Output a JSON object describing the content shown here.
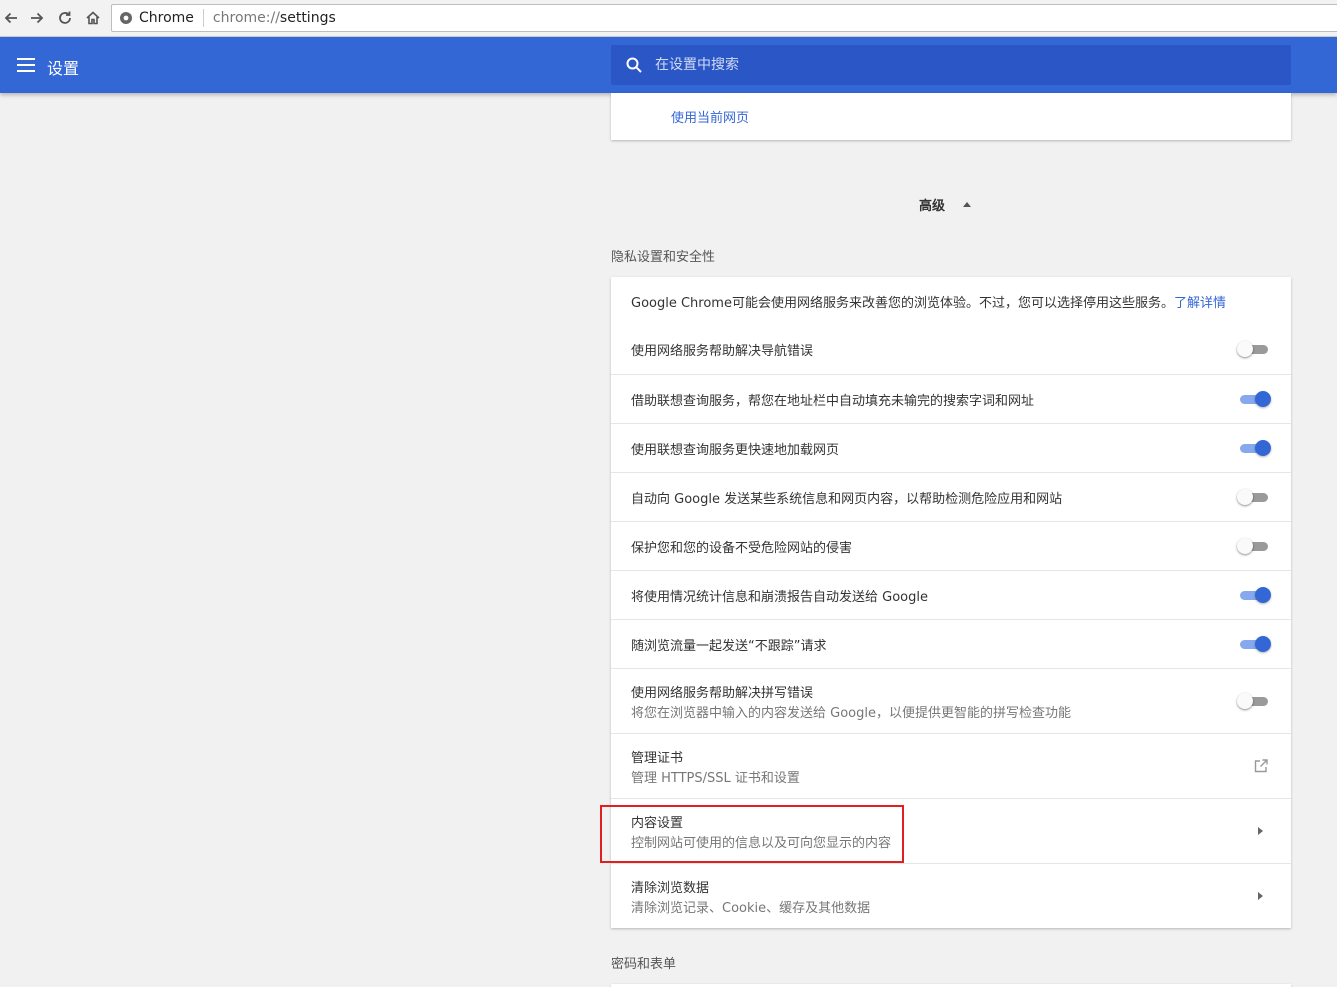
{
  "browser": {
    "site_name": "Chrome",
    "url_scheme": "chrome://",
    "url_path": "settings"
  },
  "header": {
    "title": "设置",
    "search_placeholder": "在设置中搜索"
  },
  "startup": {
    "use_current_pages": "使用当前网页"
  },
  "advanced": {
    "label": "高级"
  },
  "privacy": {
    "section_title": "隐私设置和安全性",
    "intro_text": "Google Chrome可能会使用网络服务来改善您的浏览体验。不过，您可以选择停用这些服务。",
    "learn_more": "了解详情",
    "toggles": [
      {
        "label": "使用网络服务帮助解决导航错误",
        "enabled": false
      },
      {
        "label": "借助联想查询服务，帮您在地址栏中自动填充未输完的搜索字词和网址",
        "enabled": true
      },
      {
        "label": "使用联想查询服务更快速地加载网页",
        "enabled": true
      },
      {
        "label": "自动向 Google 发送某些系统信息和网页内容，以帮助检测危险应用和网站",
        "enabled": false
      },
      {
        "label": "保护您和您的设备不受危险网站的侵害",
        "enabled": false
      },
      {
        "label": "将使用情况统计信息和崩溃报告自动发送给 Google",
        "enabled": true
      },
      {
        "label": "随浏览流量一起发送“不跟踪”请求",
        "enabled": true
      }
    ],
    "spelling": {
      "label": "使用网络服务帮助解决拼写错误",
      "sub": "将您在浏览器中输入的内容发送给 Google，以便提供更智能的拼写检查功能",
      "enabled": false
    },
    "certificates": {
      "label": "管理证书",
      "sub": "管理 HTTPS/SSL 证书和设置"
    },
    "content_settings": {
      "label": "内容设置",
      "sub": "控制网站可使用的信息以及可向您显示的内容"
    },
    "clear_data": {
      "label": "清除浏览数据",
      "sub": "清除浏览记录、Cookie、缓存及其他数据"
    }
  },
  "passwords": {
    "section_title": "密码和表单"
  },
  "colors": {
    "header_blue": "#3367d6",
    "search_blue": "#2a56c6",
    "highlight_red": "#e02020"
  }
}
